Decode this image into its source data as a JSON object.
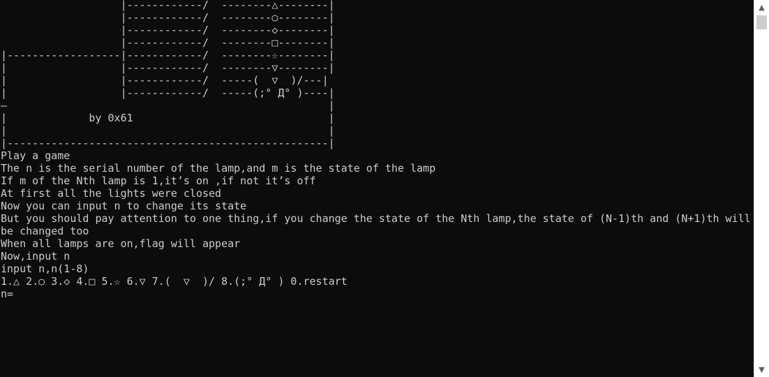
{
  "console": {
    "lines": [
      "                   |------------/  --------△--------|",
      "                   |------------/  --------○--------|",
      "                   |------------/  --------◇--------|",
      "                   |------------/  --------□--------|",
      "|------------------|------------/  --------☆--------|",
      "|                  |------------/  --------▽--------|",
      "|                  |------------/  -----(  ▽  )/---|",
      "|                  |------------/  -----(;° Д° )----|",
      "—                                                   |",
      "|             by 0x61                               |",
      "|                                                   |",
      "|---------------------------------------------------|",
      "Play a game",
      "The n is the serial number of the lamp,and m is the state of the lamp",
      "If m of the Nth lamp is 1,it’s on ,if not it’s off",
      "At first all the lights were closed",
      "Now you can input n to change its state",
      "But you should pay attention to one thing,if you change the state of the Nth lamp,the state of (N-1)th and (N+1)th will",
      "be changed too",
      "When all lamps are on,flag will appear",
      "Now,input n",
      "input n,n(1-8)",
      "1.△ 2.○ 3.◇ 4.□ 5.☆ 6.▽ 7.(  ▽  )/ 8.(;° Д° ) 0.restart",
      "n="
    ]
  },
  "scrollbar": {
    "up_arrow": "▲",
    "down_arrow": "▼"
  }
}
